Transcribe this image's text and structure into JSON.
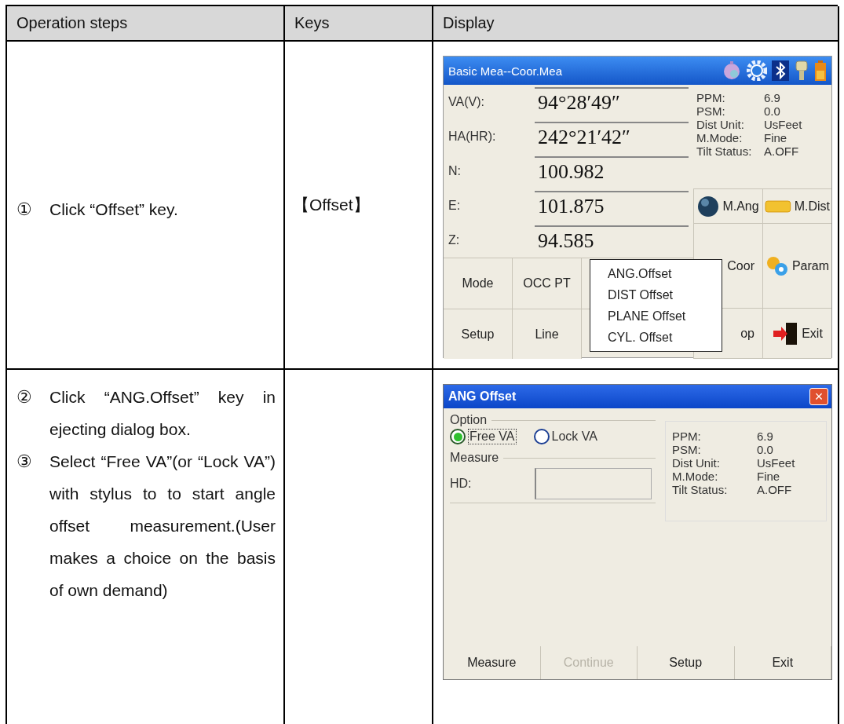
{
  "table": {
    "columns": [
      "Operation steps",
      "Keys",
      "Display"
    ],
    "rows": [
      {
        "steps": [
          {
            "number": "①",
            "text": "Click “Offset” key."
          }
        ],
        "key": "【Offset】",
        "display": {
          "kind": "basic",
          "title": "Basic Mea--Coor.Mea",
          "fields": [
            {
              "label": "VA(V):",
              "value": "94°28′49″"
            },
            {
              "label": "HA(HR):",
              "value": "242°21′42″"
            },
            {
              "label": "N:",
              "value": "100.982"
            },
            {
              "label": "E:",
              "value": "101.875"
            },
            {
              "label": "Z:",
              "value": "94.585"
            }
          ],
          "info": [
            {
              "label": "PPM:",
              "value": "6.9"
            },
            {
              "label": "PSM:",
              "value": "0.0"
            },
            {
              "label": "Dist Unit:",
              "value": "UsFeet"
            },
            {
              "label": "M.Mode:",
              "value": "Fine"
            },
            {
              "label": "Tilt Status:",
              "value": "A.OFF"
            }
          ],
          "side_buttons": [
            {
              "label": "M.Ang",
              "kind": "sphere"
            },
            {
              "label": "M.Dist",
              "kind": "bar"
            },
            {
              "label": "Coor",
              "kind": "hidden"
            },
            {
              "label": "Param",
              "kind": "gears"
            },
            {
              "label": "op",
              "kind": "hidden"
            },
            {
              "label": "Exit",
              "kind": "door"
            }
          ],
          "toolbar": [
            [
              "Mode",
              "OCC PT"
            ],
            [
              "Setup",
              "Line"
            ]
          ],
          "menu": [
            "ANG.Offset",
            "DIST Offset",
            "PLANE Offset",
            "CYL. Offset"
          ]
        }
      },
      {
        "steps": [
          {
            "number": "②",
            "text": "Click “ANG.Offset” key in ejecting dialog box."
          },
          {
            "number": "③",
            "text": "Select “Free VA”(or “Lock VA”) with stylus to to start angle offset measurement.(User makes a choice on the basis of own demand)"
          }
        ],
        "display": {
          "kind": "dialog",
          "title": "ANG Offset",
          "close": "×",
          "option_group": "Option",
          "options": [
            {
              "label": "Free VA",
              "selected": true
            },
            {
              "label": "Lock VA",
              "selected": false
            }
          ],
          "measure_group": "Measure",
          "field_label": "HD:",
          "info": [
            {
              "label": "PPM:",
              "value": "6.9"
            },
            {
              "label": "PSM:",
              "value": "0.0"
            },
            {
              "label": "Dist Unit:",
              "value": "UsFeet"
            },
            {
              "label": "M.Mode:",
              "value": "Fine"
            },
            {
              "label": "Tilt Status:",
              "value": "A.OFF"
            }
          ],
          "buttons": [
            {
              "label": "Measure",
              "disabled": false
            },
            {
              "label": "Continue",
              "disabled": true
            },
            {
              "label": "Setup",
              "disabled": false
            },
            {
              "label": "Exit",
              "disabled": false
            }
          ]
        }
      }
    ]
  }
}
